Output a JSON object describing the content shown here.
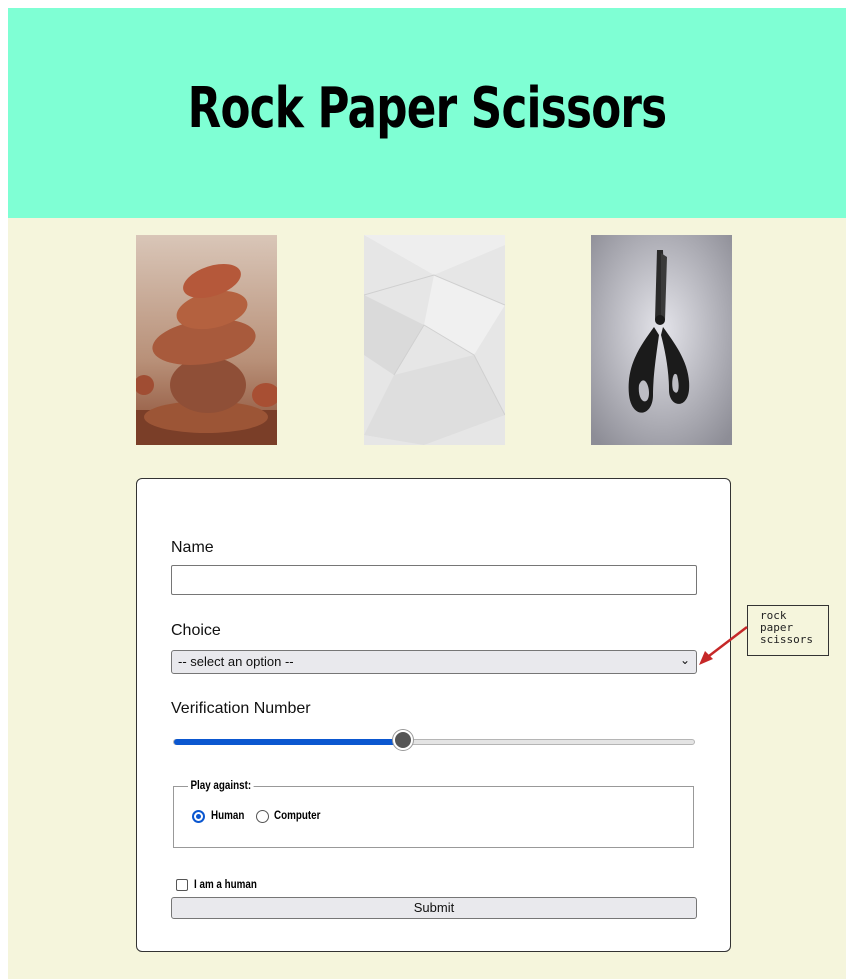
{
  "title": "Rock Paper Scissors",
  "images": [
    {
      "name": "rock-image",
      "icon": "stacked-rocks"
    },
    {
      "name": "paper-image",
      "icon": "crumpled-paper"
    },
    {
      "name": "scissors-image",
      "icon": "scissors"
    }
  ],
  "form": {
    "name_label": "Name",
    "name_value": "",
    "choice_label": "Choice",
    "choice_selected": "-- select an option --",
    "verification_label": "Verification Number",
    "verification_value_fraction": 0.44,
    "play_against_legend": "Play against:",
    "options": [
      {
        "label": "Human",
        "selected": true
      },
      {
        "label": "Computer",
        "selected": false
      }
    ],
    "human_checkbox_label": "I am a human",
    "human_checked": false,
    "submit_label": "Submit"
  },
  "annotation": {
    "lines": [
      "rock",
      "paper",
      "scissors"
    ],
    "arrow_color": "#c62828"
  },
  "colors": {
    "header_bg": "#7fffd4",
    "page_bg": "#f5f5dc",
    "accent": "#0b57d0"
  }
}
